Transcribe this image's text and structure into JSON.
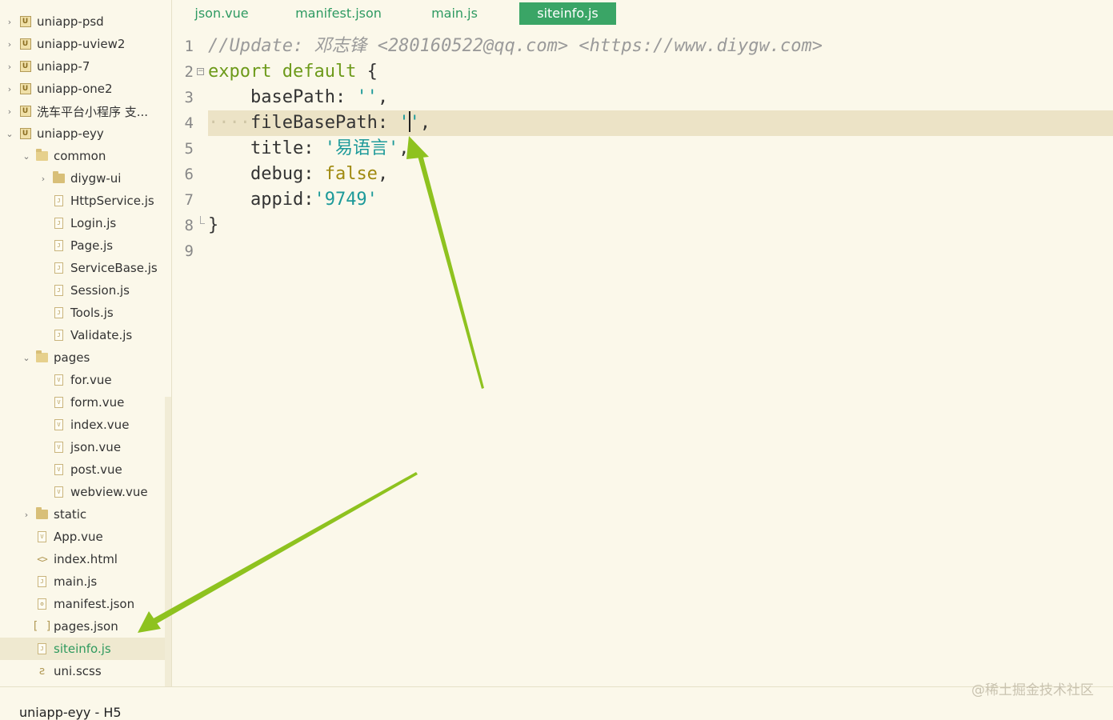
{
  "sidebar": {
    "rows": [
      {
        "label": "uniapp-psd",
        "icon": "project-icon",
        "expanded": false
      },
      {
        "label": "uniapp-uview2",
        "icon": "project-icon",
        "expanded": false
      },
      {
        "label": "uniapp-7",
        "icon": "project-icon",
        "expanded": false
      },
      {
        "label": "uniapp-one2",
        "icon": "project-icon",
        "expanded": false
      },
      {
        "label": "洗车平台小程序 支...",
        "icon": "project-icon",
        "expanded": false
      },
      {
        "label": "uniapp-eyy",
        "icon": "project-icon",
        "expanded": true
      },
      {
        "label": "common",
        "icon": "folder-open-icon",
        "expanded": true
      },
      {
        "label": "diygw-ui",
        "icon": "folder-icon",
        "expanded": false
      },
      {
        "label": "HttpService.js",
        "icon": "js-file-icon"
      },
      {
        "label": "Login.js",
        "icon": "js-file-icon"
      },
      {
        "label": "Page.js",
        "icon": "js-file-icon"
      },
      {
        "label": "ServiceBase.js",
        "icon": "js-file-icon"
      },
      {
        "label": "Session.js",
        "icon": "js-file-icon"
      },
      {
        "label": "Tools.js",
        "icon": "js-file-icon"
      },
      {
        "label": "Validate.js",
        "icon": "js-file-icon"
      },
      {
        "label": "pages",
        "icon": "folder-open-icon",
        "expanded": true
      },
      {
        "label": "for.vue",
        "icon": "vue-file-icon"
      },
      {
        "label": "form.vue",
        "icon": "vue-file-icon"
      },
      {
        "label": "index.vue",
        "icon": "vue-file-icon"
      },
      {
        "label": "json.vue",
        "icon": "vue-file-icon"
      },
      {
        "label": "post.vue",
        "icon": "vue-file-icon"
      },
      {
        "label": "webview.vue",
        "icon": "vue-file-icon"
      },
      {
        "label": "static",
        "icon": "folder-icon",
        "expanded": false
      },
      {
        "label": "App.vue",
        "icon": "vue-file-icon"
      },
      {
        "label": "index.html",
        "icon": "html-file-icon"
      },
      {
        "label": "main.js",
        "icon": "js-file-icon"
      },
      {
        "label": "manifest.json",
        "icon": "json-config-icon"
      },
      {
        "label": "pages.json",
        "icon": "json-file-icon"
      },
      {
        "label": "siteinfo.js",
        "icon": "js-file-icon",
        "selected": true
      },
      {
        "label": "uni.scss",
        "icon": "scss-file-icon"
      }
    ]
  },
  "tabs": [
    {
      "label": "json.vue",
      "active": false
    },
    {
      "label": "manifest.json",
      "active": false
    },
    {
      "label": "main.js",
      "active": false
    },
    {
      "label": "siteinfo.js",
      "active": true
    }
  ],
  "editor": {
    "line_numbers": [
      "1",
      "2",
      "3",
      "4",
      "5",
      "6",
      "7",
      "8",
      "9"
    ],
    "lines": {
      "l1_comment": "//Update: 邓志锋 <280160522@qq.com> <https://www.diygw.com>",
      "l2_keyword": "export default",
      "l2_brace": " {",
      "l3_key": "    basePath: ",
      "l3_value": "''",
      "l3_end": ",",
      "l4_dots": "····",
      "l4_key": "fileBasePath: ",
      "l4_value_open": "'",
      "l4_value_close": "'",
      "l4_end": ",",
      "l5_key": "    title: ",
      "l5_value": "'易语言'",
      "l5_end": ",",
      "l6_key": "    debug: ",
      "l6_value": "false",
      "l6_end": ",",
      "l7_key": "    appid:",
      "l7_value": "'9749'",
      "l8_brace": "}"
    },
    "current_line": "4"
  },
  "status": {
    "project": "uniapp-eyy - H5"
  },
  "watermark": "@稀土掘金技术社区",
  "colors": {
    "background": "#fbf8ea",
    "accent": "#3aa566",
    "arrow": "#8ec21f"
  }
}
